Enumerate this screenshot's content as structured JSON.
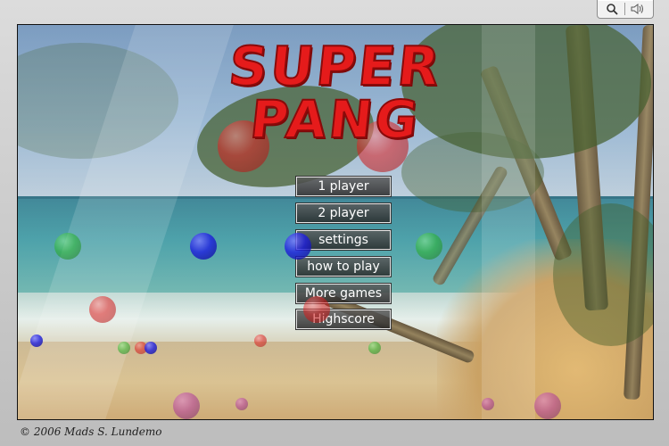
{
  "toolbar": {
    "zoom_icon": "magnifier-icon",
    "sound_icon": "speaker-icon"
  },
  "game": {
    "title_line1": "SUPER",
    "title_line2": "PANG",
    "menu": [
      {
        "label": "1 player"
      },
      {
        "label": "2 player"
      },
      {
        "label": "settings"
      },
      {
        "label": "how to play"
      },
      {
        "label": "More games"
      },
      {
        "label": "Highscore"
      }
    ]
  },
  "footer": {
    "copyright": "© 2006 Mads S. Lundemo"
  },
  "colors": {
    "title": "#e51b1b",
    "ball_red": "#e02020",
    "ball_blue": "#1f1fe0",
    "ball_green": "#28b428",
    "ball_purple": "#b0389e"
  }
}
